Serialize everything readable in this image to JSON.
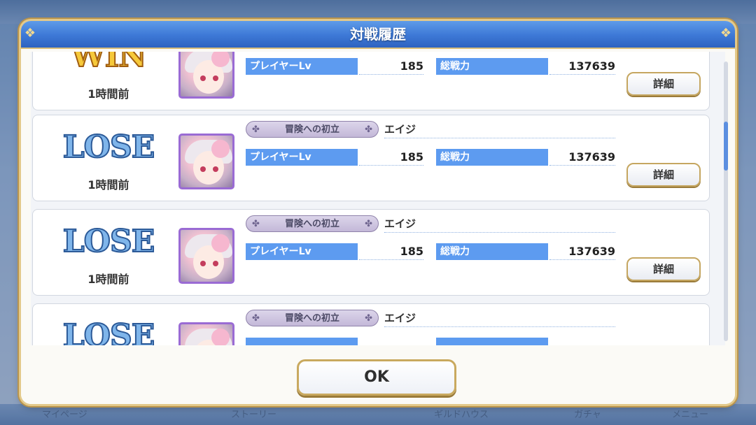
{
  "background": {
    "tabs": [
      "マイページ",
      "ストーリー",
      "ギルドハウス",
      "ガチャ",
      "メニュー"
    ]
  },
  "dialog": {
    "title": "対戦履歴",
    "ok_label": "OK"
  },
  "labels": {
    "player_lv": "プレイヤーLv",
    "total_power": "総戦力",
    "detail": "詳細"
  },
  "matches": [
    {
      "result": "WIN",
      "time": "1時間前",
      "clan": "",
      "player_name": "",
      "player_lv": "185",
      "total_power": "137639"
    },
    {
      "result": "LOSE",
      "time": "1時間前",
      "clan": "冒険への初立",
      "player_name": "エイジ",
      "player_lv": "185",
      "total_power": "137639"
    },
    {
      "result": "LOSE",
      "time": "1時間前",
      "clan": "冒険への初立",
      "player_name": "エイジ",
      "player_lv": "185",
      "total_power": "137639"
    },
    {
      "result": "LOSE",
      "time": "",
      "clan": "冒険への初立",
      "player_name": "エイジ",
      "player_lv": "",
      "total_power": ""
    }
  ],
  "colors": {
    "title_bar": "#3d78d6",
    "stat_label_bg": "#5d9bf0",
    "gold_border": "#c9a95f",
    "avatar_frame": "#9a6bd4"
  }
}
